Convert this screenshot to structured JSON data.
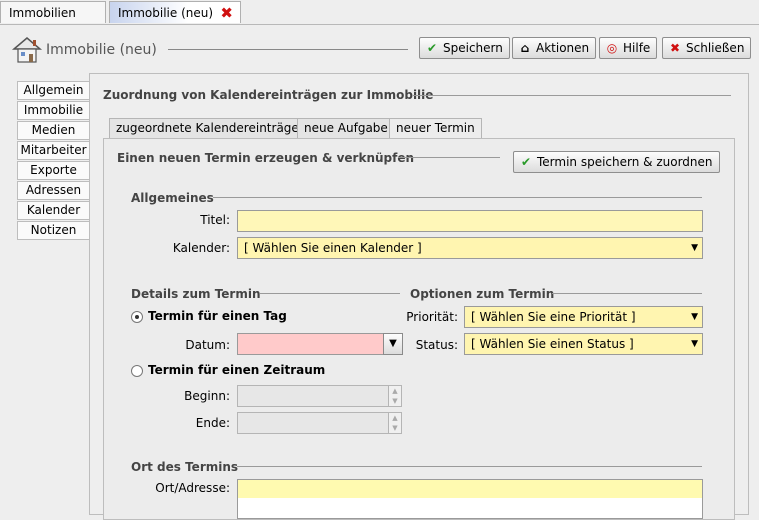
{
  "tabs": [
    {
      "label": "Immobilien"
    },
    {
      "label": "Immobilie (neu)"
    }
  ],
  "header": {
    "title": "Immobilie (neu)",
    "buttons": {
      "save": "Speichern",
      "actions": "Aktionen",
      "help": "Hilfe",
      "close": "Schließen"
    }
  },
  "sidebar": {
    "items": [
      "Allgemein",
      "Immobilie",
      "Medien",
      "Mitarbeiter",
      "Exporte",
      "Adressen",
      "Kalender",
      "Notizen"
    ]
  },
  "main": {
    "section_title": "Zuordnung von Kalendereinträgen zur Immobilie",
    "subtabs": [
      "zugeordnete Kalendereinträge",
      "neue Aufgabe",
      "neuer Termin"
    ],
    "panel_title": "Einen neuen Termin erzeugen & verknüpfen",
    "save_assign_button": "Termin speichern & zuordnen",
    "allgemeines": {
      "title": "Allgemeines",
      "titel_label": "Titel:",
      "titel_value": "",
      "kalender_label": "Kalender:",
      "kalender_value": "[ Wählen Sie einen Kalender ]"
    },
    "details": {
      "title": "Details zum Termin",
      "radio_day": "Termin für einen Tag",
      "datum_label": "Datum:",
      "datum_value": "",
      "radio_range": "Termin für einen Zeitraum",
      "beginn_label": "Beginn:",
      "ende_label": "Ende:"
    },
    "optionen": {
      "title": "Optionen zum Termin",
      "prioritaet_label": "Priorität:",
      "prioritaet_value": "[ Wählen Sie eine Priorität ]",
      "status_label": "Status:",
      "status_value": "[ Wählen Sie einen Status ]"
    },
    "ort": {
      "title": "Ort des Termins",
      "label": "Ort/Adresse:",
      "value": ""
    }
  }
}
